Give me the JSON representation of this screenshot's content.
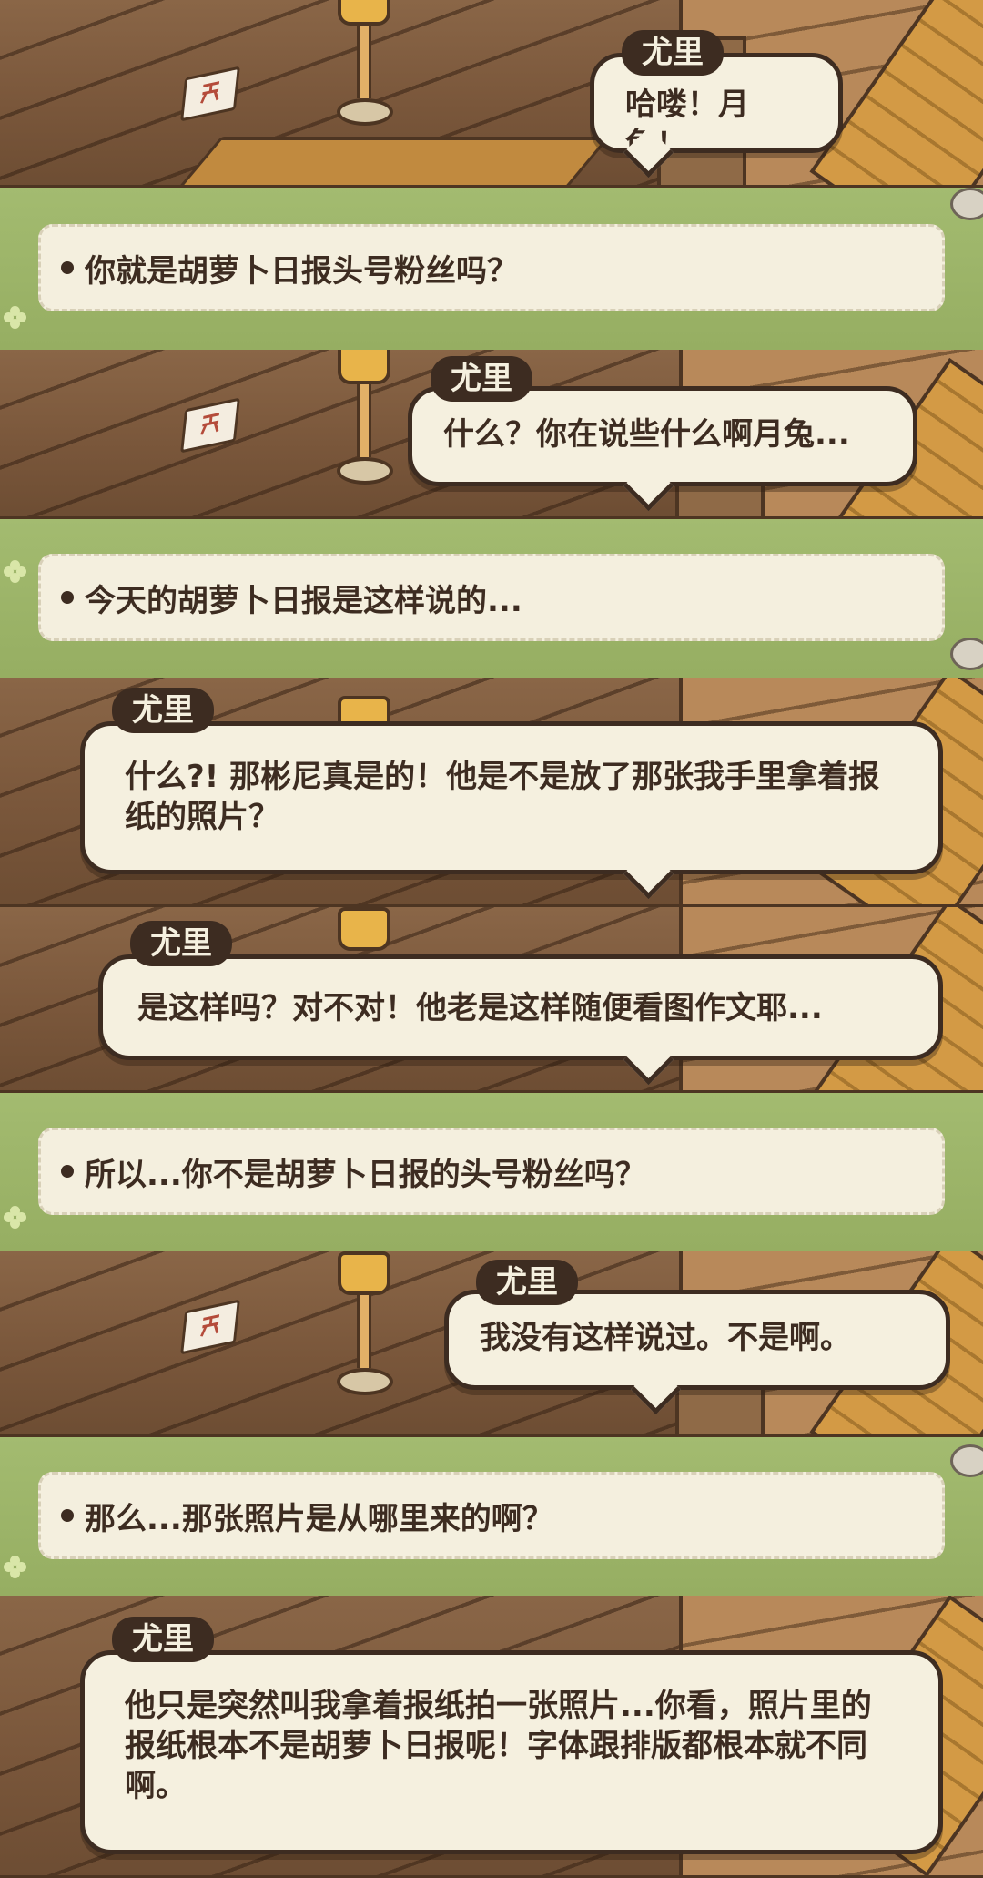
{
  "speaker": "尤里",
  "panels": [
    {
      "type": "dialog",
      "speaker": "尤里",
      "text": "哈喽！月兔！"
    },
    {
      "type": "choice",
      "text": "你就是胡萝卜日报头号粉丝吗？"
    },
    {
      "type": "dialog",
      "speaker": "尤里",
      "text": "什么？你在说些什么啊月兔..."
    },
    {
      "type": "choice",
      "text": "今天的胡萝卜日报是这样说的..."
    },
    {
      "type": "dialog",
      "speaker": "尤里",
      "text": "什么?! 那彬尼真是的！他是不是放了那张我手里拿着报纸的照片？"
    },
    {
      "type": "dialog",
      "speaker": "尤里",
      "text": "是这样吗？对不对！他老是这样随便看图作文耶..."
    },
    {
      "type": "choice",
      "text": "所以...你不是胡萝卜日报的头号粉丝吗？"
    },
    {
      "type": "dialog",
      "speaker": "尤里",
      "text": "我没有这样说过。不是啊。"
    },
    {
      "type": "choice",
      "text": "那么...那张照片是从哪里来的啊？"
    },
    {
      "type": "dialog",
      "speaker": "尤里",
      "text": "他只是突然叫我拿着报纸拍一张照片...你看，照片里的报纸根本不是胡萝卜日报呢！字体跟排版都根本就不同啊。"
    }
  ],
  "colors": {
    "bubble_fill": "#f5f0df",
    "outline": "#3d2c21",
    "choice_bar": "#9cb46a",
    "floor": "#7a573b"
  },
  "icons": [
    "lamp-icon",
    "sale-sign-icon",
    "bullet-icon",
    "clover-icon"
  ]
}
